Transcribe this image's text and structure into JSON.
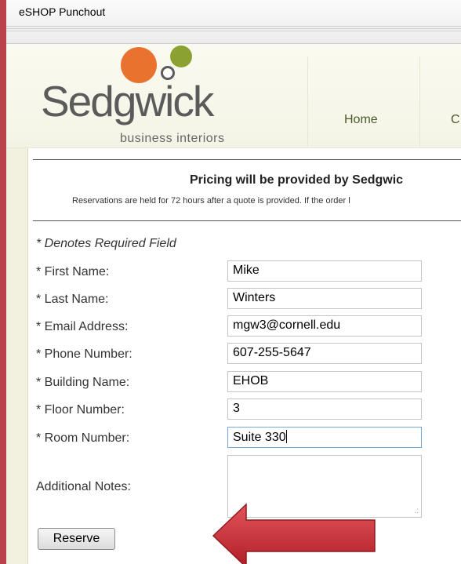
{
  "window": {
    "title": "eSHOP Punchout"
  },
  "logo": {
    "name": "Sedgwick",
    "tagline": "business interiors"
  },
  "nav": {
    "items": [
      "Home",
      "C"
    ]
  },
  "banner": {
    "heading": "Pricing will be provided by Sedgwic",
    "note": "Reservations are held for 72 hours after a quote is provided.  If the order l"
  },
  "form": {
    "required_note": "* Denotes Required Field",
    "fields": [
      {
        "label": "* First Name:",
        "value": "Mike"
      },
      {
        "label": "* Last Name:",
        "value": "Winters"
      },
      {
        "label": "* Email Address:",
        "value": "mgw3@cornell.edu"
      },
      {
        "label": "* Phone Number:",
        "value": "607-255-5647"
      },
      {
        "label": "* Building Name:",
        "value": "EHOB"
      },
      {
        "label": "* Floor Number:",
        "value": "3"
      },
      {
        "label": "* Room Number:",
        "value": "Suite 330"
      }
    ],
    "notes_label": "Additional Notes:",
    "notes_value": "",
    "submit_label": "Reserve"
  },
  "colors": {
    "frame": "#b8434a",
    "logo_orange": "#e9722f",
    "logo_green": "#8ba232",
    "nav_text": "#4a5a2a",
    "arrow": "#c8262e"
  },
  "icons": [
    "resize-grip-icon",
    "callout-arrow-icon"
  ]
}
